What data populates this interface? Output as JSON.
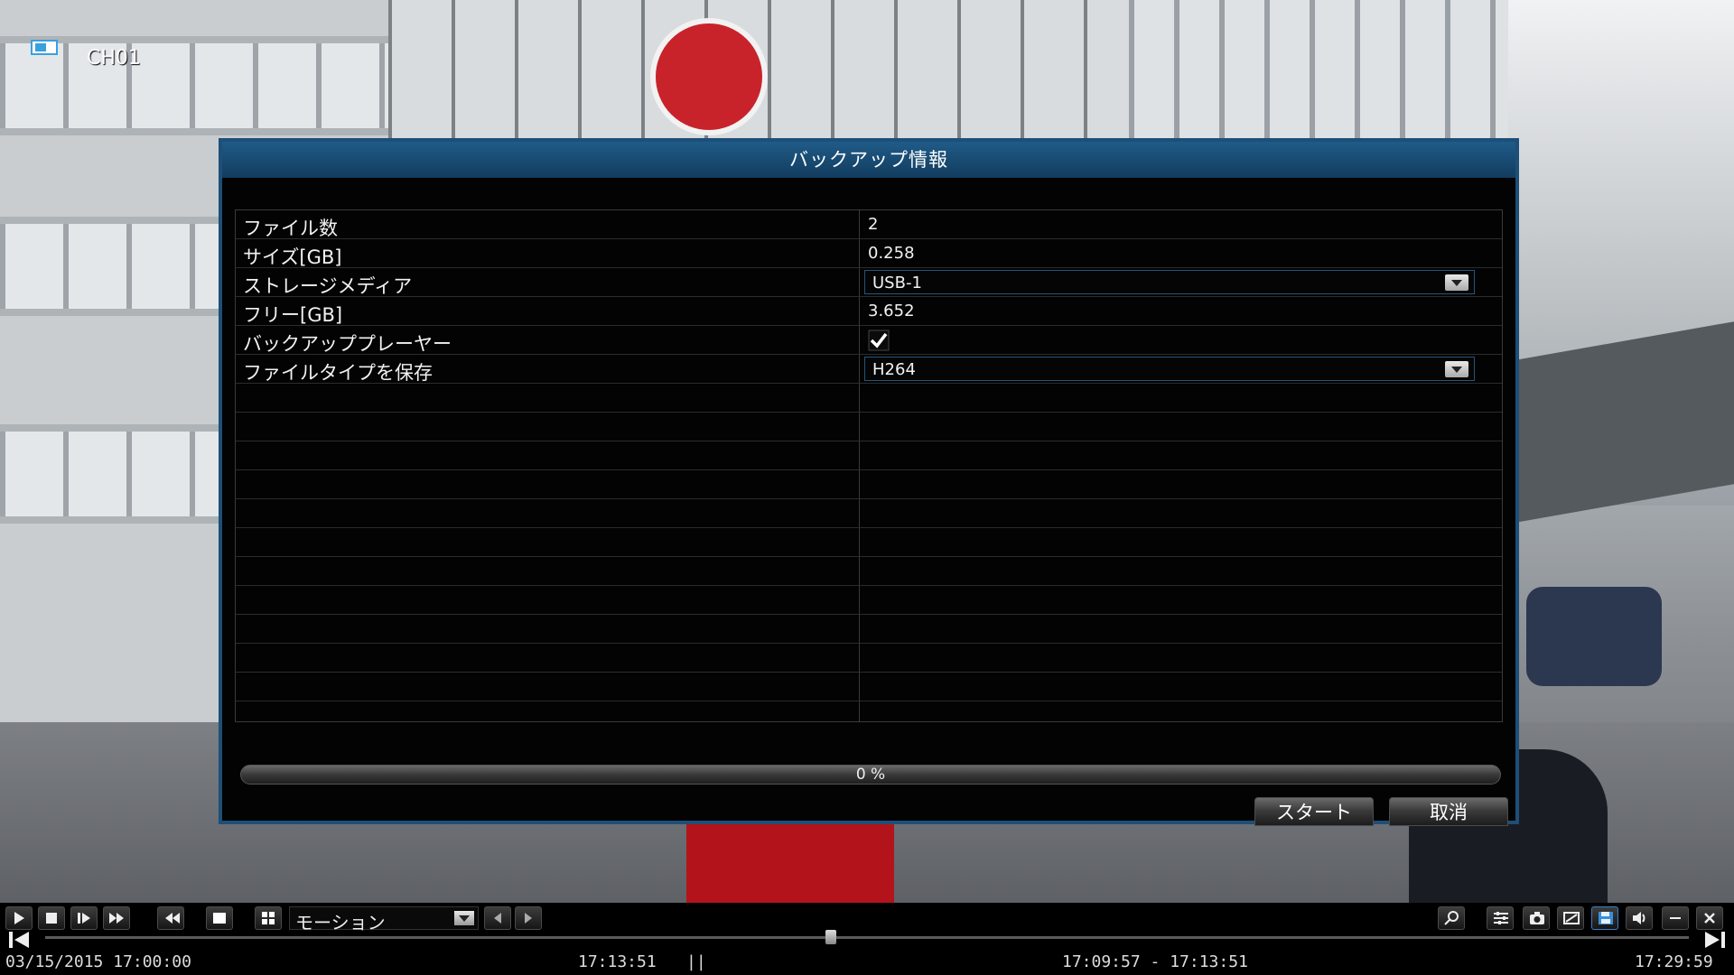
{
  "channel": {
    "label": "CH01"
  },
  "dialog": {
    "title": "バックアップ情報",
    "rows": [
      {
        "label": "ファイル数",
        "value": "2"
      },
      {
        "label": "サイズ[GB]",
        "value": "0.258"
      },
      {
        "label": "ストレージメディア",
        "value": "USB-1"
      },
      {
        "label": "フリー[GB]",
        "value": "3.652"
      },
      {
        "label": "バックアッププレーヤー",
        "checked": true
      },
      {
        "label": "ファイルタイプを保存",
        "value": "H264"
      }
    ],
    "progress": {
      "text": "0 %",
      "percent": 0
    },
    "buttons": {
      "start": "スタート",
      "cancel": "取消"
    }
  },
  "playback": {
    "mode": "モーション",
    "start_datetime": "03/15/2015 17:00:00",
    "current_time": "17:13:51",
    "pause_indicator": "||",
    "range": "17:09:57 - 17:13:51",
    "end_time": "17:29:59",
    "timeline_position": 0.478
  },
  "colors": {
    "dialog_header": "#1f5b88",
    "dialog_border": "#1d4f78",
    "accent": "#25547c"
  }
}
